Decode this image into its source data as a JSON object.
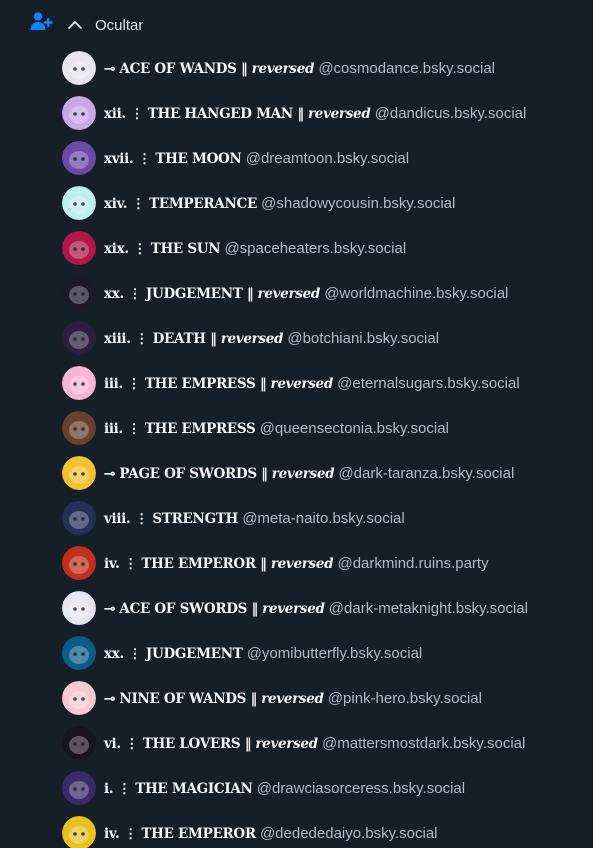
{
  "header": {
    "toggle_label": "Ocultar",
    "icons": {
      "add_user": "add-user-icon",
      "chevron": "chevron-up-icon"
    },
    "accent_color": "#1083fe"
  },
  "accounts": [
    {
      "prefix": "⊸ ACE OF WANDS ‖",
      "reversed": "reversed",
      "handle": "@cosmodance.bsky.social",
      "avatar": "#e7e3ef"
    },
    {
      "prefix": "xii. ⋮ THE HANGED MAN ‖",
      "reversed": "reversed",
      "handle": "@dandicus.bsky.social",
      "avatar": "#c9a6e6"
    },
    {
      "prefix": "xvii. ⋮ THE MOON",
      "reversed": "",
      "handle": "@dreamtoon.bsky.social",
      "avatar": "#6b4aa8"
    },
    {
      "prefix": "xiv. ⋮ TEMPERANCE",
      "reversed": "",
      "handle": "@shadowycousin.bsky.social",
      "avatar": "#bfeef0"
    },
    {
      "prefix": "xix. ⋮ THE SUN",
      "reversed": "",
      "handle": "@spaceheaters.bsky.social",
      "avatar": "#b0164a"
    },
    {
      "prefix": "xx. ⋮ JUDGEMENT ‖",
      "reversed": "reversed",
      "handle": "@worldmachine.bsky.social",
      "avatar": "#1c1a2a"
    },
    {
      "prefix": "xiii. ⋮ DEATH ‖",
      "reversed": "reversed",
      "handle": "@botchiani.bsky.social",
      "avatar": "#2b1e3e"
    },
    {
      "prefix": "iii. ⋮ THE EMPRESS ‖",
      "reversed": "reversed",
      "handle": "@eternalsugars.bsky.social",
      "avatar": "#f6b6d8"
    },
    {
      "prefix": "iii. ⋮ THE EMPRESS",
      "reversed": "",
      "handle": "@queensectonia.bsky.social",
      "avatar": "#6a4030"
    },
    {
      "prefix": "⊸ PAGE OF SWORDS ‖",
      "reversed": "reversed",
      "handle": "@dark-taranza.bsky.social",
      "avatar": "#f2c230"
    },
    {
      "prefix": "viii. ⋮ STRENGTH",
      "reversed": "",
      "handle": "@meta-naito.bsky.social",
      "avatar": "#25305a"
    },
    {
      "prefix": "iv. ⋮ THE EMPEROR ‖",
      "reversed": "reversed",
      "handle": "@darkmind.ruins.party",
      "avatar": "#c0301c"
    },
    {
      "prefix": "⊸ ACE OF SWORDS ‖",
      "reversed": "reversed",
      "handle": "@dark-metaknight.bsky.social",
      "avatar": "#e8e6f0"
    },
    {
      "prefix": "xx. ⋮ JUDGEMENT",
      "reversed": "",
      "handle": "@yomibutterfly.bsky.social",
      "avatar": "#0c5c8a"
    },
    {
      "prefix": "⊸ NINE OF WANDS ‖",
      "reversed": "reversed",
      "handle": "@pink-hero.bsky.social",
      "avatar": "#f8c8d0"
    },
    {
      "prefix": "vi. ⋮ THE LOVERS ‖",
      "reversed": "reversed",
      "handle": "@mattersmostdark.bsky.social",
      "avatar": "#1a1420"
    },
    {
      "prefix": "i. ⋮ THE MAGICIAN",
      "reversed": "",
      "handle": "@drawciasorceress.bsky.social",
      "avatar": "#3a2a6a"
    },
    {
      "prefix": "iv. ⋮ THE EMPEROR",
      "reversed": "",
      "handle": "@dedededaiyo.bsky.social",
      "avatar": "#e8c020"
    }
  ]
}
